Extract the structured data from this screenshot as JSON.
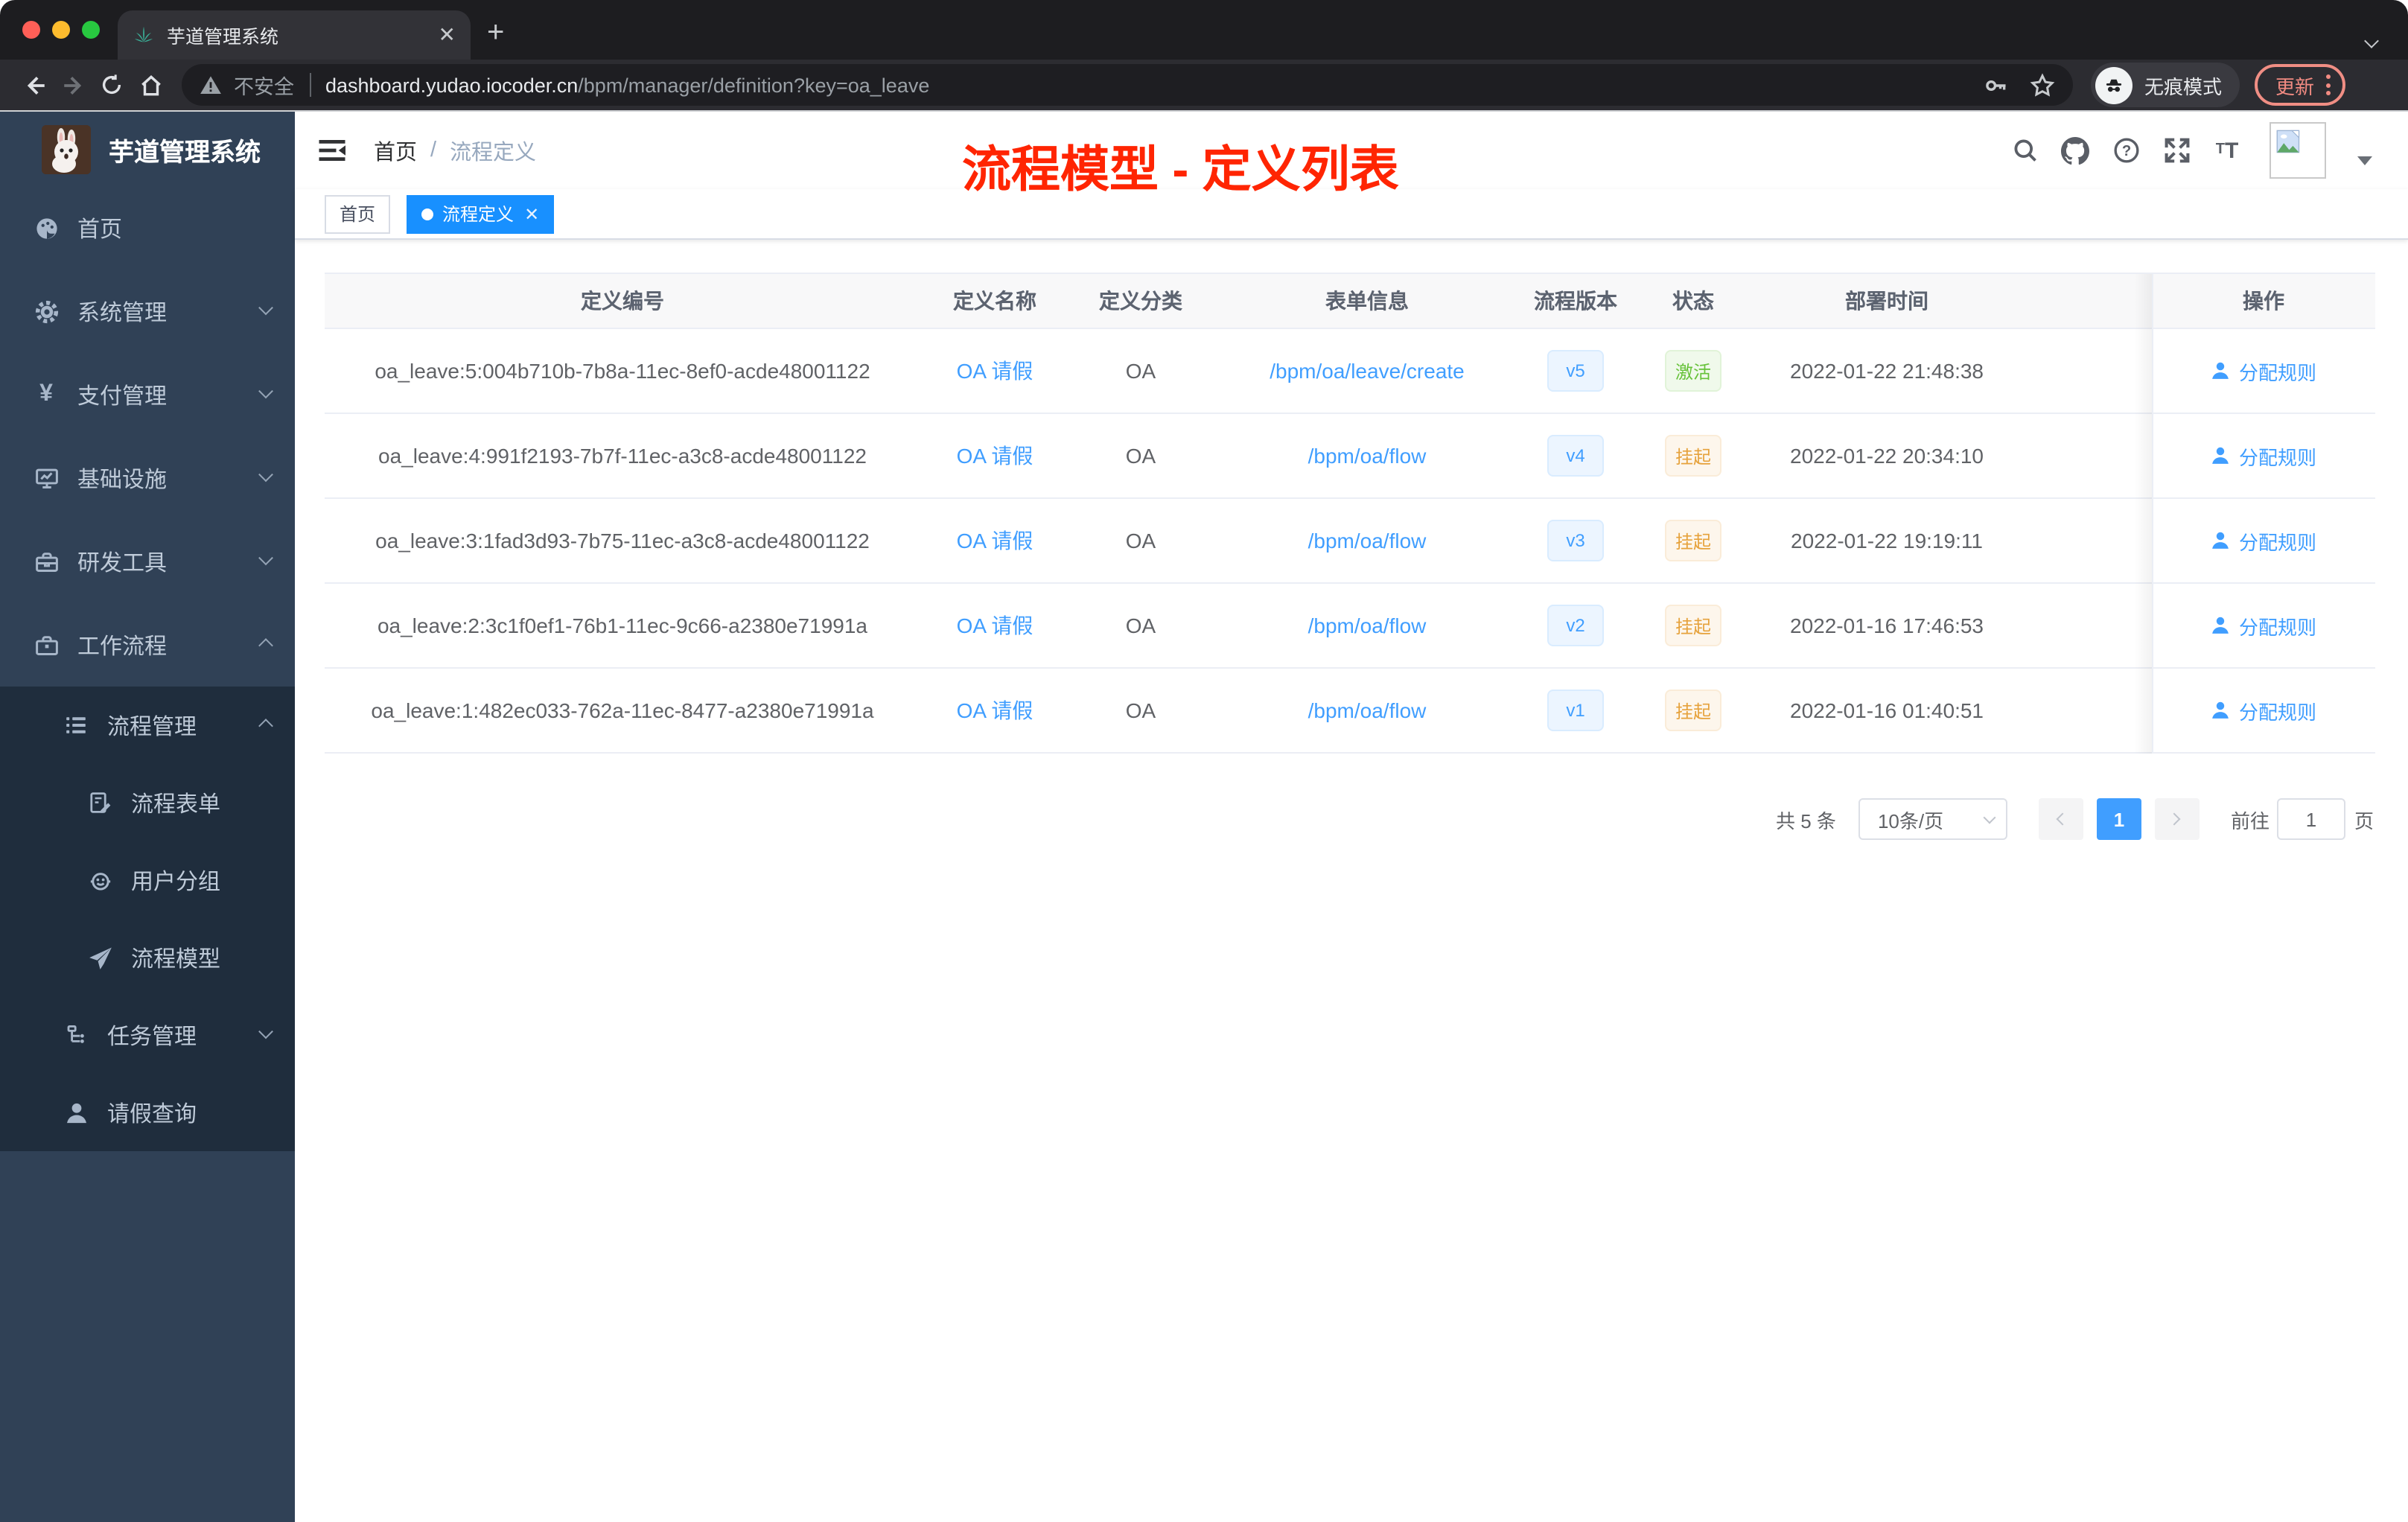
{
  "browser": {
    "tab_title": "芋道管理系统",
    "security_label": "不安全",
    "url_host": "dashboard.yudao.iocoder.cn",
    "url_path": "/bpm/manager/definition?key=oa_leave",
    "incognito_label": "无痕模式",
    "update_label": "更新"
  },
  "sidebar": {
    "logo_title": "芋道管理系统",
    "items": [
      {
        "label": "首页",
        "icon": "dashboard-icon"
      },
      {
        "label": "系统管理",
        "icon": "gear-icon"
      },
      {
        "label": "支付管理",
        "icon": "yen-icon"
      },
      {
        "label": "基础设施",
        "icon": "infrastructure-icon"
      },
      {
        "label": "研发工具",
        "icon": "devtools-icon"
      },
      {
        "label": "工作流程",
        "icon": "workflow-icon"
      }
    ],
    "workflow_children": [
      {
        "label": "流程管理",
        "icon": "process-list-icon",
        "level": 1
      },
      {
        "label": "流程表单",
        "icon": "form-icon",
        "level": 2
      },
      {
        "label": "用户分组",
        "icon": "user-group-icon",
        "level": 2
      },
      {
        "label": "流程模型",
        "icon": "paper-plane-icon",
        "level": 2
      },
      {
        "label": "任务管理",
        "icon": "task-tree-icon",
        "level": 1
      },
      {
        "label": "请假查询",
        "icon": "person-icon",
        "level": 1
      }
    ]
  },
  "navbar": {
    "breadcrumb": [
      "首页",
      "流程定义"
    ],
    "separator": "/"
  },
  "annotation": {
    "title": "流程模型 - 定义列表"
  },
  "tags_view": {
    "tabs": [
      {
        "label": "首页",
        "active": false
      },
      {
        "label": "流程定义",
        "active": true
      }
    ]
  },
  "table": {
    "columns": [
      "定义编号",
      "定义名称",
      "定义分类",
      "表单信息",
      "流程版本",
      "状态",
      "部署时间",
      "操作"
    ],
    "rows": [
      {
        "id": "oa_leave:5:004b710b-7b8a-11ec-8ef0-acde48001122",
        "name": "OA 请假",
        "category": "OA",
        "form": "/bpm/oa/leave/create",
        "version": "v5",
        "status": "激活",
        "status_type": "success",
        "time": "2022-01-22 21:48:38",
        "action": "分配规则"
      },
      {
        "id": "oa_leave:4:991f2193-7b7f-11ec-a3c8-acde48001122",
        "name": "OA 请假",
        "category": "OA",
        "form": "/bpm/oa/flow",
        "version": "v4",
        "status": "挂起",
        "status_type": "warning",
        "time": "2022-01-22 20:34:10",
        "action": "分配规则"
      },
      {
        "id": "oa_leave:3:1fad3d93-7b75-11ec-a3c8-acde48001122",
        "name": "OA 请假",
        "category": "OA",
        "form": "/bpm/oa/flow",
        "version": "v3",
        "status": "挂起",
        "status_type": "warning",
        "time": "2022-01-22 19:19:11",
        "action": "分配规则"
      },
      {
        "id": "oa_leave:2:3c1f0ef1-76b1-11ec-9c66-a2380e71991a",
        "name": "OA 请假",
        "category": "OA",
        "form": "/bpm/oa/flow",
        "version": "v2",
        "status": "挂起",
        "status_type": "warning",
        "time": "2022-01-16 17:46:53",
        "action": "分配规则"
      },
      {
        "id": "oa_leave:1:482ec033-762a-11ec-8477-a2380e71991a",
        "name": "OA 请假",
        "category": "OA",
        "form": "/bpm/oa/flow",
        "version": "v1",
        "status": "挂起",
        "status_type": "warning",
        "time": "2022-01-16 01:40:51",
        "action": "分配规则"
      }
    ]
  },
  "pagination": {
    "total_text": "共 5 条",
    "page_size": "10条/页",
    "current_page": "1",
    "goto_label": "前往",
    "goto_value": "1",
    "page_unit": "页"
  },
  "colors": {
    "accent_blue": "#409eff",
    "tags_active_blue": "#1890ff",
    "annotation_red": "#ff2502",
    "sidebar_bg": "#304156",
    "submenu_bg": "#1f2d3d",
    "status_active_green": "#67c23a",
    "status_suspend_orange": "#e6a23c"
  }
}
